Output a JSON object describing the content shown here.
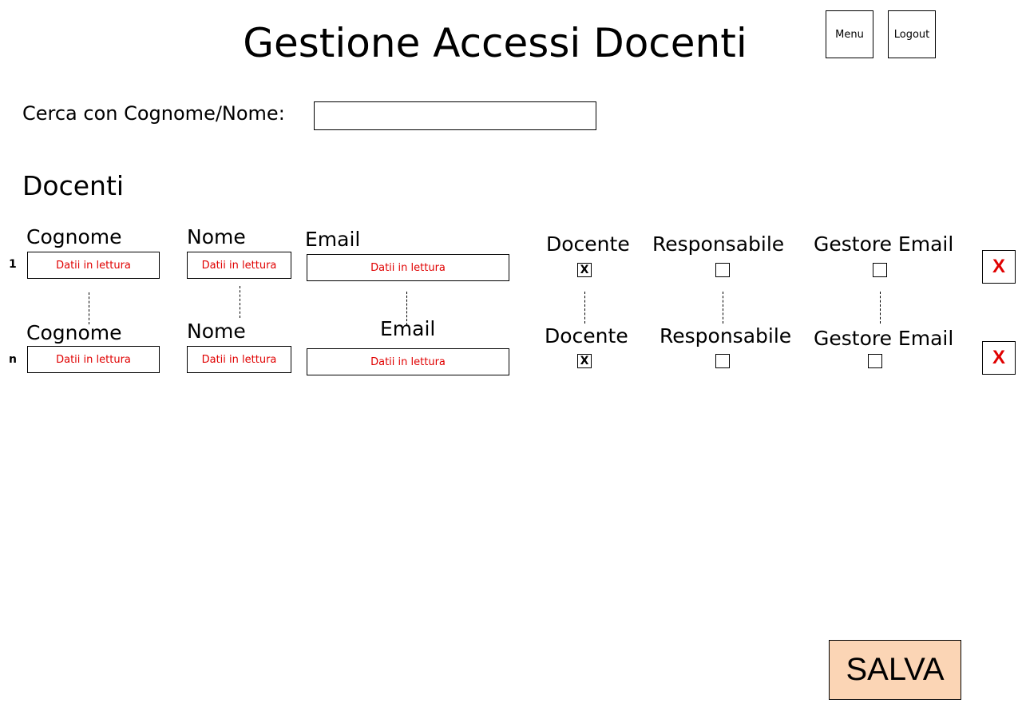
{
  "header": {
    "title": "Gestione Accessi Docenti",
    "menu_label": "Menu",
    "logout_label": "Logout"
  },
  "search": {
    "label": "Cerca con Cognome/Nome:",
    "value": ""
  },
  "section_title": "Docenti",
  "columns": {
    "cognome": "Cognome",
    "nome": "Nome",
    "email": "Email",
    "docente": "Docente",
    "responsabile": "Responsabile",
    "gestore_email": "Gestore Email"
  },
  "rows": [
    {
      "index": "1",
      "cognome": "Datii in lettura",
      "nome": "Datii in lettura",
      "email": "Datii in lettura",
      "docente_mark": "X",
      "responsabile_mark": "",
      "gestore_email_mark": "",
      "delete_label": "X"
    },
    {
      "index": "n",
      "cognome": "Datii in lettura",
      "nome": "Datii in lettura",
      "email": "Datii in lettura",
      "docente_mark": "X",
      "responsabile_mark": "",
      "gestore_email_mark": "",
      "delete_label": "X"
    }
  ],
  "save_label": "SALVA",
  "colors": {
    "readonly_text": "#e00000",
    "delete_x": "#e00000",
    "save_bg": "#fbd5b5"
  }
}
